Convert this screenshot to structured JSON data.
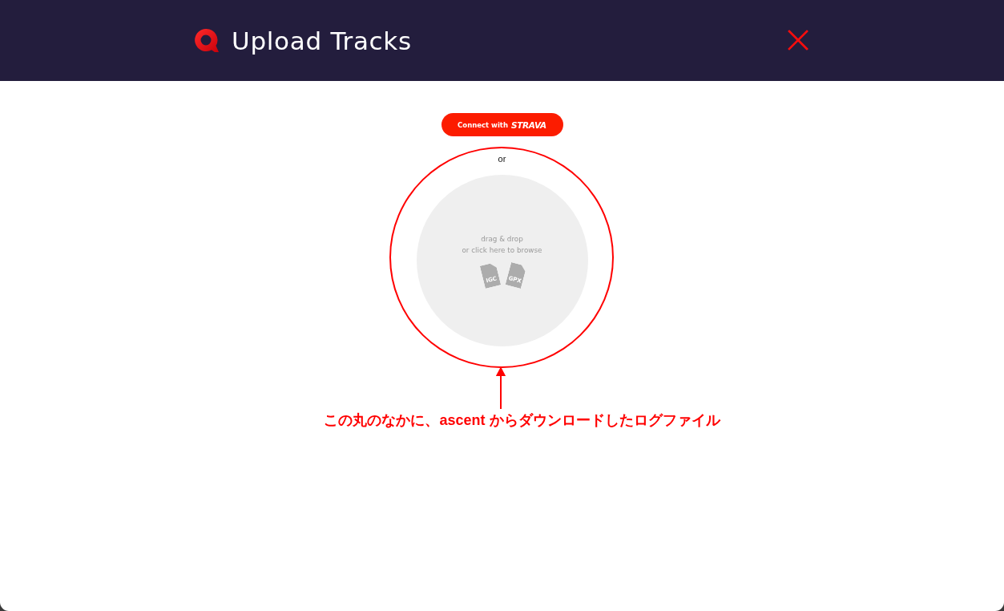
{
  "header": {
    "title": "Upload Tracks"
  },
  "connect_button": {
    "label": "Connect with",
    "brand": "STRAVA"
  },
  "separator": "or",
  "drop_zone": {
    "line_1": "drag & drop",
    "line_2": "or click here to browse",
    "file_types": [
      "IGC",
      "GPX"
    ]
  },
  "annotation": {
    "text": "この丸のなかに、ascent からダウンロードしたログファイル"
  }
}
